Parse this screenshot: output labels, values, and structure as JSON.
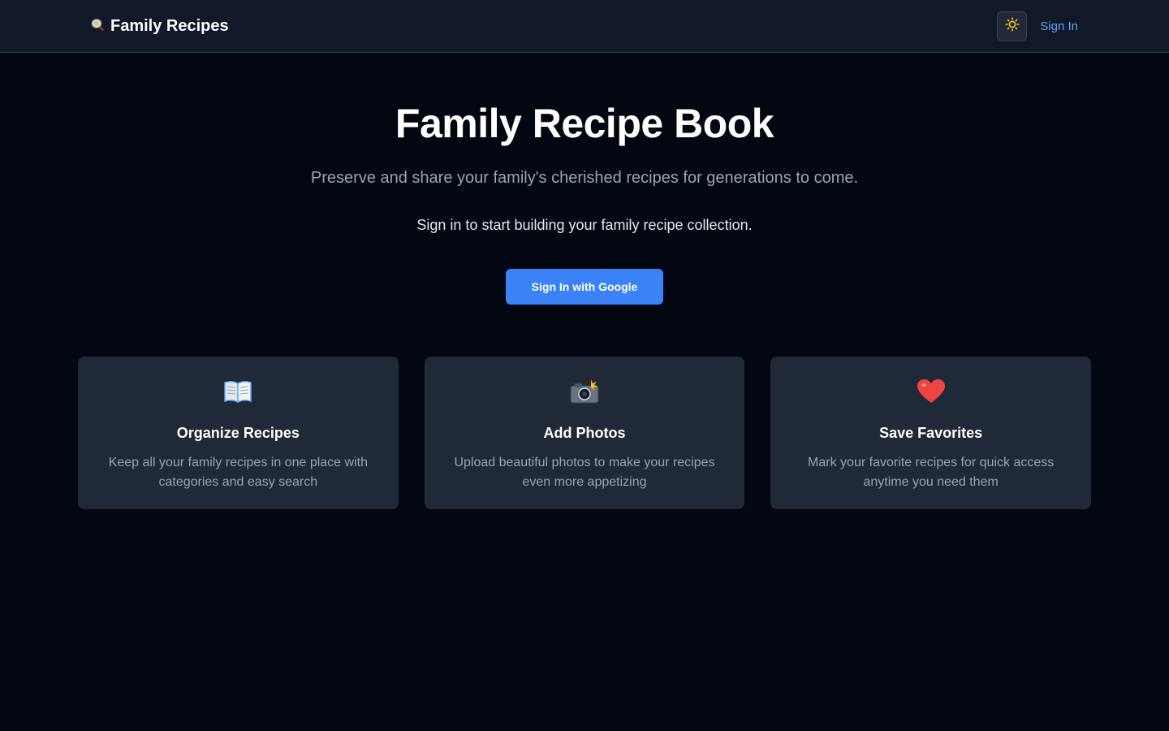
{
  "navbar": {
    "brand_icon": "frying-pan-icon",
    "brand_label": "Family Recipes",
    "theme_toggle_icon": "sun-icon",
    "signin_label": "Sign In"
  },
  "hero": {
    "title": "Family Recipe Book",
    "subtitle": "Preserve and share your family's cherished recipes for generations to come.",
    "prompt": "Sign in to start building your family recipe collection.",
    "google_button_label": "Sign In with Google"
  },
  "features": [
    {
      "icon": "open-book-icon",
      "title": "Organize Recipes",
      "description": "Keep all your family recipes in one place with categories and easy search"
    },
    {
      "icon": "camera-flash-icon",
      "title": "Add Photos",
      "description": "Upload beautiful photos to make your recipes even more appetizing"
    },
    {
      "icon": "heart-icon",
      "title": "Save Favorites",
      "description": "Mark your favorite recipes for quick access anytime you need them"
    }
  ],
  "colors": {
    "page_background": "#030712",
    "navbar_background": "#111827",
    "card_background": "#1f2937",
    "accent_blue": "#3b82f6",
    "link_blue": "#60a5fa",
    "sun_yellow": "#facc15",
    "heart_red": "#ef4444"
  }
}
